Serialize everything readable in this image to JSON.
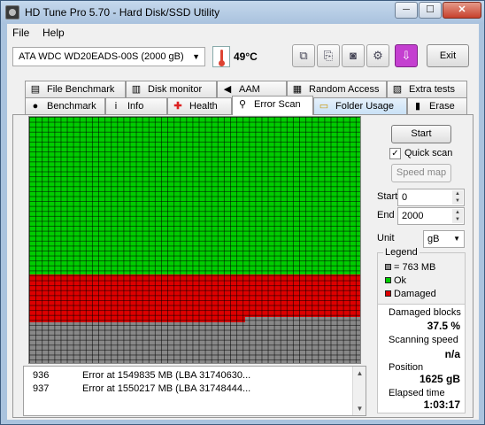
{
  "window": {
    "title": "HD Tune Pro 5.70 - Hard Disk/SSD Utility",
    "min_glyph": "─",
    "max_glyph": "☐",
    "close_glyph": "✕"
  },
  "menu": [
    {
      "label": "File"
    },
    {
      "label": "Help"
    }
  ],
  "toolbar": {
    "drive": "ATA    WDC WD20EADS-00S (2000 gB)",
    "temperature": "49°C",
    "exit_label": "Exit",
    "icons": [
      "copy-icon",
      "copy-text-icon",
      "camera-icon",
      "options-icon",
      "save-download-icon"
    ]
  },
  "tabs_top": [
    {
      "label": "File Benchmark",
      "icon": "file-benchmark-icon"
    },
    {
      "label": "Disk monitor",
      "icon": "disk-monitor-icon"
    },
    {
      "label": "AAM",
      "icon": "speaker-icon"
    },
    {
      "label": "Random Access",
      "icon": "random-access-icon"
    },
    {
      "label": "Extra tests",
      "icon": "extra-tests-icon"
    }
  ],
  "tabs_bottom": [
    {
      "label": "Benchmark",
      "icon": "benchmark-icon"
    },
    {
      "label": "Info",
      "icon": "info-icon"
    },
    {
      "label": "Health",
      "icon": "health-icon"
    },
    {
      "label": "Error Scan",
      "icon": "search-icon",
      "active": true
    },
    {
      "label": "Folder Usage",
      "icon": "folder-icon"
    },
    {
      "label": "Erase",
      "icon": "trash-icon"
    }
  ],
  "scan_map": {
    "ok_fraction": 0.625,
    "damaged_fraction": 0.375,
    "colors": {
      "ok": "#00cc00",
      "damaged": "#dd0000",
      "unscanned": "#888888"
    }
  },
  "log": [
    {
      "num": "936",
      "message": "Error at 1549835 MB (LBA 31740630..."
    },
    {
      "num": "937",
      "message": "Error at 1550217 MB (LBA 31748444..."
    }
  ],
  "controls": {
    "start_label": "Start",
    "quick_scan_label": "Quick scan",
    "quick_scan_checked": true,
    "speed_map_label": "Speed map",
    "start_field_label": "Start",
    "start_value": "0",
    "end_field_label": "End",
    "end_value": "2000",
    "unit_label": "Unit",
    "unit_value": "gB"
  },
  "legend": {
    "title": "Legend",
    "items": [
      {
        "label": "= 763 MB",
        "color": "#888888"
      },
      {
        "label": "Ok",
        "color": "#00cc00"
      },
      {
        "label": "Damaged",
        "color": "#dd0000"
      }
    ]
  },
  "stats": {
    "damaged_blocks_label": "Damaged blocks",
    "damaged_blocks_value": "37.5 %",
    "scanning_speed_label": "Scanning speed",
    "scanning_speed_value": "n/a",
    "position_label": "Position",
    "position_value": "1625 gB",
    "elapsed_label": "Elapsed time",
    "elapsed_value": "1:03:17"
  }
}
